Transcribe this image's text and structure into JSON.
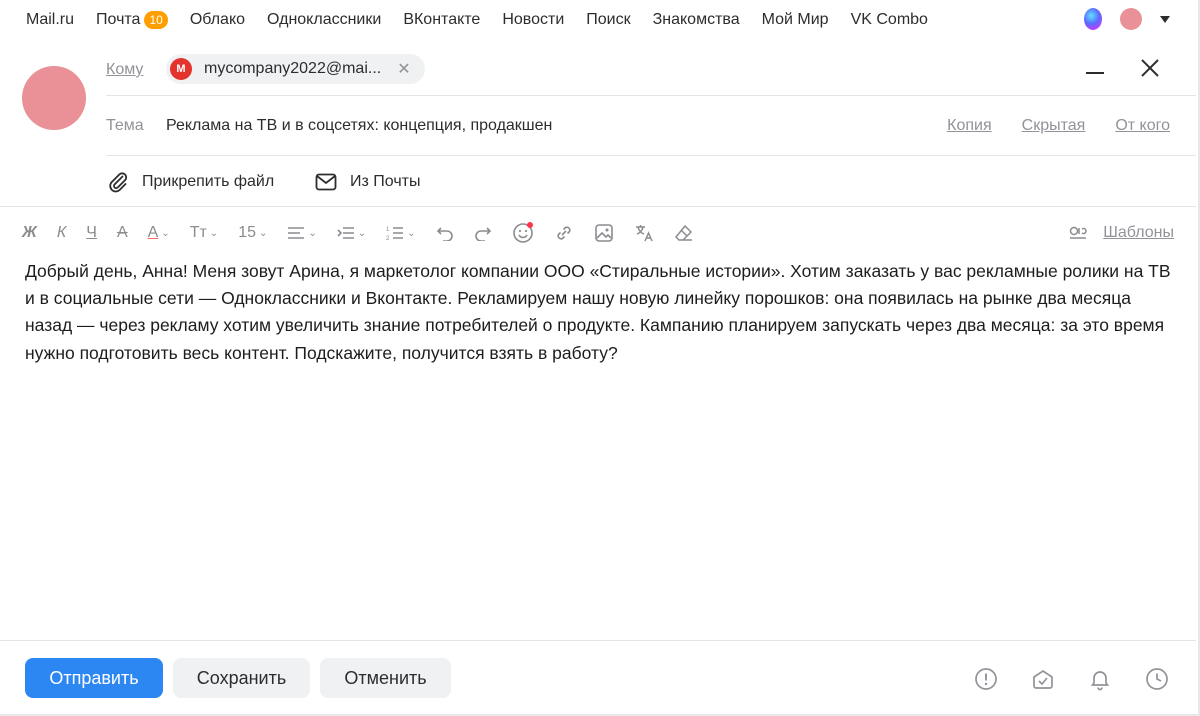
{
  "portal": {
    "brand": "Mail.ru",
    "items": [
      "Почта",
      "Облако",
      "Одноклассники",
      "ВКонтакте",
      "Новости",
      "Поиск",
      "Знакомства",
      "Мой Мир",
      "VK Combo"
    ],
    "mail_badge": "10"
  },
  "compose": {
    "to_label": "Кому",
    "recipient_initial": "M",
    "recipient": "mycompany2022@mai...",
    "subject_label": "Тема",
    "subject": "Реклама на ТВ и в соцсетях: концепция, продакшен",
    "copy_label": "Копия",
    "hidden_label": "Скрытая",
    "from_label": "От кого",
    "attach_file": "Прикрепить файл",
    "from_mail": "Из Почты"
  },
  "toolbar": {
    "bold": "Ж",
    "italic": "К",
    "underline": "Ч",
    "strike": "А",
    "text_color": "А",
    "font_style": "Тт",
    "font_size": "15",
    "templates": "Шаблоны"
  },
  "body": {
    "text": "Добрый день, Анна! Меня зовут Арина, я маркетолог компании ООО «Стиральные истории». Хотим заказать у вас рекламные ролики на ТВ и в социальные сети — Одноклассники и Вконтакте. Рекламируем нашу новую линейку порошков: она появилась на рынке два месяца назад — через рекламу хотим увеличить знание потребителей о продукте. Кампанию планируем запускать через два месяца: за это время нужно подготовить весь контент. Подскажите, получится взять в работу?"
  },
  "footer": {
    "send": "Отправить",
    "save": "Сохранить",
    "cancel": "Отменить"
  },
  "colors": {
    "accent": "#2d87f3",
    "badge": "#ff9e00",
    "avatar": "#e99196",
    "recipient_logo": "#e4332c"
  }
}
